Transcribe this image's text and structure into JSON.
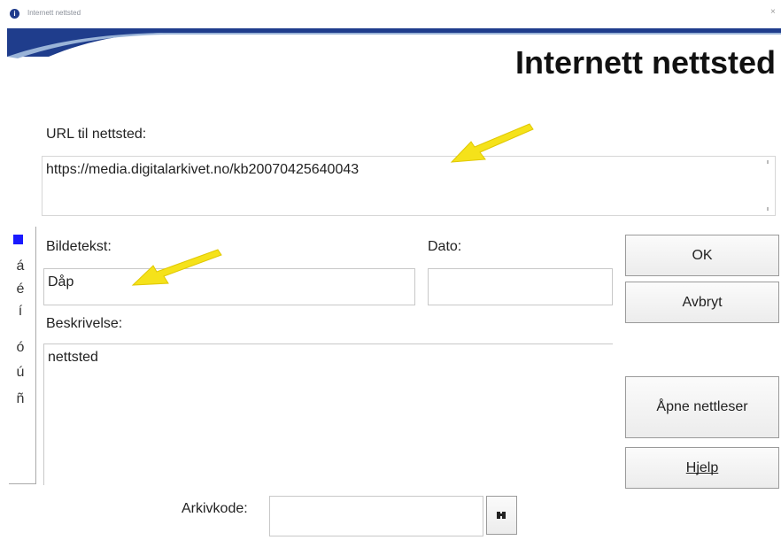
{
  "window": {
    "title": "Internett nettsted",
    "icon": "app-info-icon"
  },
  "header": {
    "title": "Internett nettsted"
  },
  "url": {
    "label": "URL til nettsted:",
    "value": "https://media.digitalarkivet.no/kb20070425640043"
  },
  "caption": {
    "label": "Bildetekst:",
    "value": "Dåp"
  },
  "date": {
    "label": "Dato:",
    "value": ""
  },
  "description": {
    "label": "Beskrivelse:",
    "value": "nettsted"
  },
  "archive": {
    "label": "Arkivkode:",
    "value": "",
    "lookup_icon": "binoculars-icon"
  },
  "buttons": {
    "ok": "OK",
    "cancel": "Avbryt",
    "open_browser": "Åpne nettleser",
    "help": "Hjelp"
  },
  "accents": [
    "á",
    "é",
    "í",
    "ó",
    "ú",
    "ñ"
  ],
  "colors": {
    "accent_square": "#1a1aff",
    "banner_blue": "#1f3d8c",
    "annotation_arrow": "#f5e21a"
  }
}
